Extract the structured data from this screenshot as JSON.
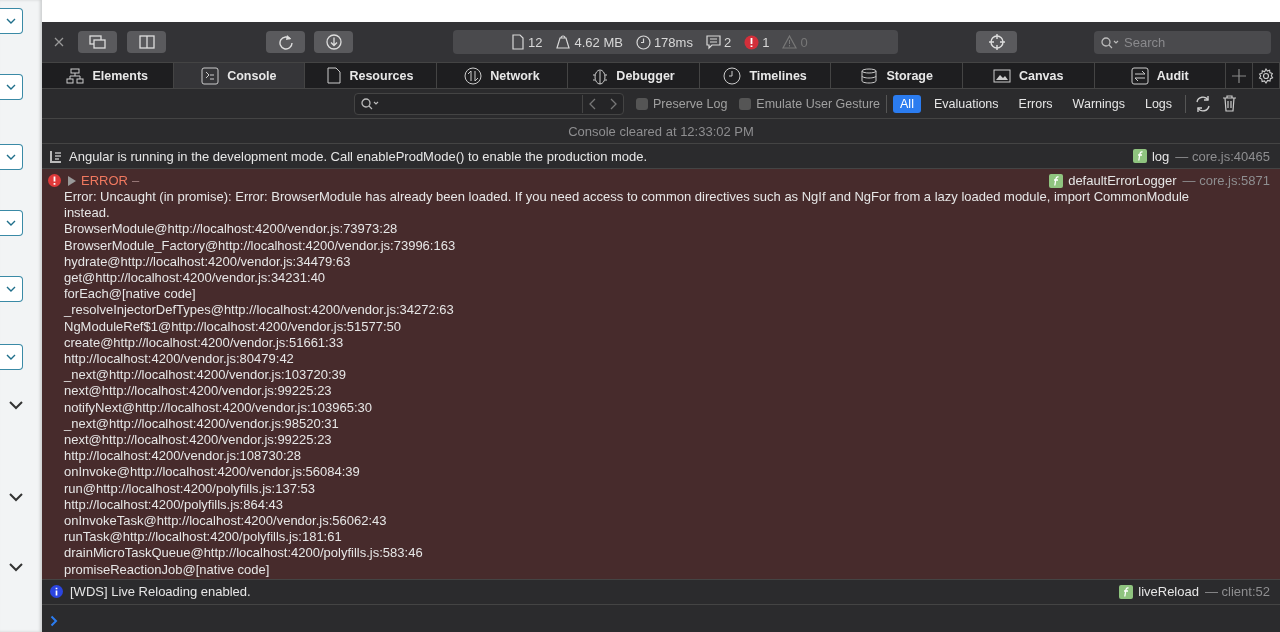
{
  "toolbar": {
    "dashboard": [
      {
        "kind": "resources",
        "value": "12",
        "disabled": false
      },
      {
        "kind": "size",
        "value": "4.62 MB",
        "disabled": false
      },
      {
        "kind": "time",
        "value": "178ms",
        "disabled": false
      },
      {
        "kind": "logs",
        "value": "2",
        "disabled": false
      },
      {
        "kind": "errors",
        "value": "1",
        "disabled": false
      },
      {
        "kind": "warnings",
        "value": "0",
        "disabled": true
      }
    ],
    "search": {
      "placeholder": "Search"
    }
  },
  "tabs": [
    {
      "kind": "elements",
      "label": "Elements",
      "selected": false
    },
    {
      "kind": "console",
      "label": "Console",
      "selected": true
    },
    {
      "kind": "resources",
      "label": "Resources",
      "selected": false
    },
    {
      "kind": "network",
      "label": "Network",
      "selected": false
    },
    {
      "kind": "debugger",
      "label": "Debugger",
      "selected": false
    },
    {
      "kind": "timelines",
      "label": "Timelines",
      "selected": false
    },
    {
      "kind": "storage",
      "label": "Storage",
      "selected": false
    },
    {
      "kind": "canvas",
      "label": "Canvas",
      "selected": false
    },
    {
      "kind": "audit",
      "label": "Audit",
      "selected": false
    }
  ],
  "filter_bar": {
    "options": [
      {
        "label": "Preserve Log",
        "checked": false
      },
      {
        "label": "Emulate User Gesture",
        "checked": false
      }
    ],
    "filters": [
      {
        "label": "All",
        "selected": true
      },
      {
        "label": "Evaluations",
        "selected": false
      },
      {
        "label": "Errors",
        "selected": false
      },
      {
        "label": "Warnings",
        "selected": false
      },
      {
        "label": "Logs",
        "selected": false
      }
    ]
  },
  "console": {
    "cleared": "Console cleared at 12:33:02 PM",
    "messages": [
      {
        "kind": "log",
        "text": "Angular is running in the development mode. Call enableProdMode() to enable the production mode.",
        "source": "log",
        "location": "— core.js:40465"
      },
      {
        "kind": "error",
        "title": "ERROR",
        "dash": "–",
        "expanded": false,
        "source": "defaultErrorLogger",
        "location": "— core.js:5871",
        "lines": [
          "Error: Uncaught (in promise): Error: BrowserModule has already been loaded. If you need access to common directives such as NgIf and NgFor from a lazy loaded module, import CommonModule instead.",
          "BrowserModule@http://localhost:4200/vendor.js:73973:28",
          "BrowserModule_Factory@http://localhost:4200/vendor.js:73996:163",
          "hydrate@http://localhost:4200/vendor.js:34479:63",
          "get@http://localhost:4200/vendor.js:34231:40",
          "forEach@[native code]",
          "_resolveInjectorDefTypes@http://localhost:4200/vendor.js:34272:63",
          "NgModuleRef$1@http://localhost:4200/vendor.js:51577:50",
          "create@http://localhost:4200/vendor.js:51661:33",
          "http://localhost:4200/vendor.js:80479:42",
          "_next@http://localhost:4200/vendor.js:103720:39",
          "next@http://localhost:4200/vendor.js:99225:23",
          "notifyNext@http://localhost:4200/vendor.js:103965:30",
          "_next@http://localhost:4200/vendor.js:98520:31",
          "next@http://localhost:4200/vendor.js:99225:23",
          "http://localhost:4200/vendor.js:108730:28",
          "onInvoke@http://localhost:4200/vendor.js:56084:39",
          "run@http://localhost:4200/polyfills.js:137:53",
          "http://localhost:4200/polyfills.js:864:43",
          "onInvokeTask@http://localhost:4200/vendor.js:56062:43",
          "runTask@http://localhost:4200/polyfills.js:181:61",
          "drainMicroTaskQueue@http://localhost:4200/polyfills.js:583:46",
          "promiseReactionJob@[native code]"
        ]
      },
      {
        "kind": "info",
        "text": "[WDS] Live Reloading enabled.",
        "source": "liveReload",
        "location": "— client:52"
      }
    ]
  }
}
